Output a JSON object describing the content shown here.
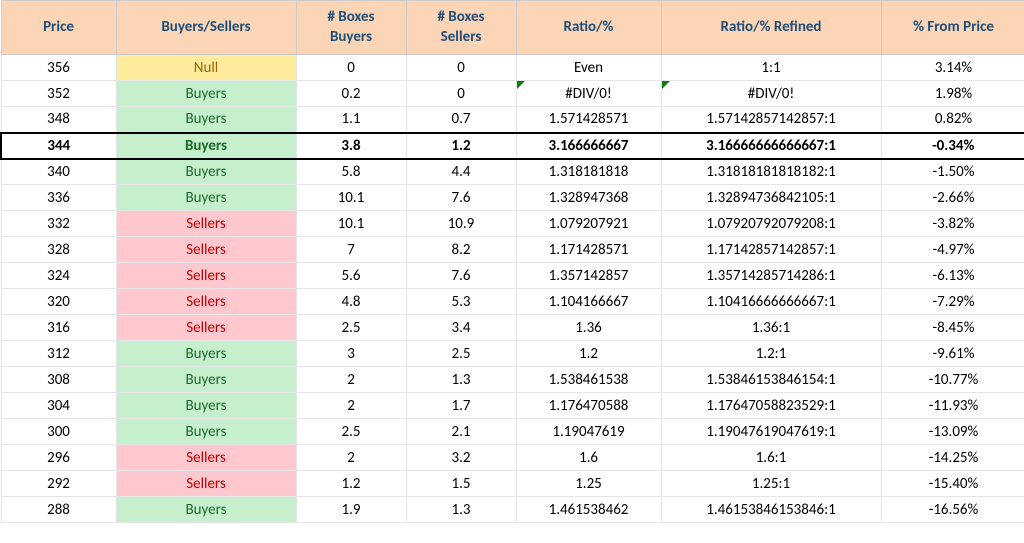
{
  "chart_data": {
    "type": "table",
    "title": "",
    "columns": [
      "Price",
      "Buyers/Sellers",
      "# Boxes Buyers",
      "# Boxes Sellers",
      "Ratio/%",
      "Ratio/% Refined",
      "% From Price"
    ],
    "rows": [
      {
        "price": "356",
        "bs": "Null",
        "bs_kind": "null",
        "boxes_b": "0",
        "boxes_s": "0",
        "ratio": "Even",
        "ratio_r": "1:1",
        "from": "3.14%",
        "err": false,
        "hl": false
      },
      {
        "price": "352",
        "bs": "Buyers",
        "bs_kind": "buyers",
        "boxes_b": "0.2",
        "boxes_s": "0",
        "ratio": "#DIV/0!",
        "ratio_r": "#DIV/0!",
        "from": "1.98%",
        "err": true,
        "hl": false
      },
      {
        "price": "348",
        "bs": "Buyers",
        "bs_kind": "buyers",
        "boxes_b": "1.1",
        "boxes_s": "0.7",
        "ratio": "1.571428571",
        "ratio_r": "1.57142857142857:1",
        "from": "0.82%",
        "err": false,
        "hl": false
      },
      {
        "price": "344",
        "bs": "Buyers",
        "bs_kind": "buyers",
        "boxes_b": "3.8",
        "boxes_s": "1.2",
        "ratio": "3.166666667",
        "ratio_r": "3.16666666666667:1",
        "from": "-0.34%",
        "err": false,
        "hl": true
      },
      {
        "price": "340",
        "bs": "Buyers",
        "bs_kind": "buyers",
        "boxes_b": "5.8",
        "boxes_s": "4.4",
        "ratio": "1.318181818",
        "ratio_r": "1.31818181818182:1",
        "from": "-1.50%",
        "err": false,
        "hl": false
      },
      {
        "price": "336",
        "bs": "Buyers",
        "bs_kind": "buyers",
        "boxes_b": "10.1",
        "boxes_s": "7.6",
        "ratio": "1.328947368",
        "ratio_r": "1.32894736842105:1",
        "from": "-2.66%",
        "err": false,
        "hl": false
      },
      {
        "price": "332",
        "bs": "Sellers",
        "bs_kind": "sellers",
        "boxes_b": "10.1",
        "boxes_s": "10.9",
        "ratio": "1.079207921",
        "ratio_r": "1.07920792079208:1",
        "from": "-3.82%",
        "err": false,
        "hl": false
      },
      {
        "price": "328",
        "bs": "Sellers",
        "bs_kind": "sellers",
        "boxes_b": "7",
        "boxes_s": "8.2",
        "ratio": "1.171428571",
        "ratio_r": "1.17142857142857:1",
        "from": "-4.97%",
        "err": false,
        "hl": false
      },
      {
        "price": "324",
        "bs": "Sellers",
        "bs_kind": "sellers",
        "boxes_b": "5.6",
        "boxes_s": "7.6",
        "ratio": "1.357142857",
        "ratio_r": "1.35714285714286:1",
        "from": "-6.13%",
        "err": false,
        "hl": false
      },
      {
        "price": "320",
        "bs": "Sellers",
        "bs_kind": "sellers",
        "boxes_b": "4.8",
        "boxes_s": "5.3",
        "ratio": "1.104166667",
        "ratio_r": "1.10416666666667:1",
        "from": "-7.29%",
        "err": false,
        "hl": false
      },
      {
        "price": "316",
        "bs": "Sellers",
        "bs_kind": "sellers",
        "boxes_b": "2.5",
        "boxes_s": "3.4",
        "ratio": "1.36",
        "ratio_r": "1.36:1",
        "from": "-8.45%",
        "err": false,
        "hl": false
      },
      {
        "price": "312",
        "bs": "Buyers",
        "bs_kind": "buyers",
        "boxes_b": "3",
        "boxes_s": "2.5",
        "ratio": "1.2",
        "ratio_r": "1.2:1",
        "from": "-9.61%",
        "err": false,
        "hl": false
      },
      {
        "price": "308",
        "bs": "Buyers",
        "bs_kind": "buyers",
        "boxes_b": "2",
        "boxes_s": "1.3",
        "ratio": "1.538461538",
        "ratio_r": "1.53846153846154:1",
        "from": "-10.77%",
        "err": false,
        "hl": false
      },
      {
        "price": "304",
        "bs": "Buyers",
        "bs_kind": "buyers",
        "boxes_b": "2",
        "boxes_s": "1.7",
        "ratio": "1.176470588",
        "ratio_r": "1.17647058823529:1",
        "from": "-11.93%",
        "err": false,
        "hl": false
      },
      {
        "price": "300",
        "bs": "Buyers",
        "bs_kind": "buyers",
        "boxes_b": "2.5",
        "boxes_s": "2.1",
        "ratio": "1.19047619",
        "ratio_r": "1.19047619047619:1",
        "from": "-13.09%",
        "err": false,
        "hl": false
      },
      {
        "price": "296",
        "bs": "Sellers",
        "bs_kind": "sellers",
        "boxes_b": "2",
        "boxes_s": "3.2",
        "ratio": "1.6",
        "ratio_r": "1.6:1",
        "from": "-14.25%",
        "err": false,
        "hl": false
      },
      {
        "price": "292",
        "bs": "Sellers",
        "bs_kind": "sellers",
        "boxes_b": "1.2",
        "boxes_s": "1.5",
        "ratio": "1.25",
        "ratio_r": "1.25:1",
        "from": "-15.40%",
        "err": false,
        "hl": false
      },
      {
        "price": "288",
        "bs": "Buyers",
        "bs_kind": "buyers",
        "boxes_b": "1.9",
        "boxes_s": "1.3",
        "ratio": "1.461538462",
        "ratio_r": "1.46153846153846:1",
        "from": "-16.56%",
        "err": false,
        "hl": false
      }
    ]
  },
  "headers": {
    "price": "Price",
    "bs": "Buyers/Sellers",
    "boxes_b_l1": "# Boxes",
    "boxes_b_l2": "Buyers",
    "boxes_s_l1": "# Boxes",
    "boxes_s_l2": "Sellers",
    "ratio": "Ratio/%",
    "ratio_r": "Ratio/% Refined",
    "from": "% From Price"
  }
}
